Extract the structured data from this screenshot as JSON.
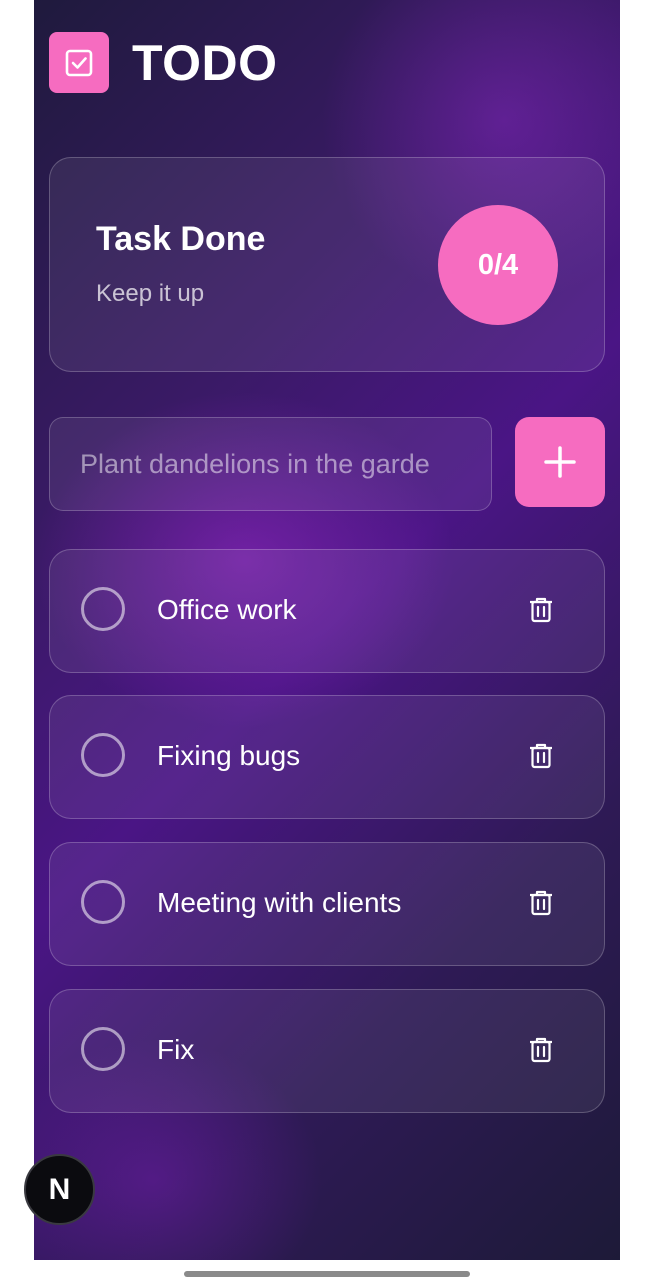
{
  "header": {
    "title": "TODO",
    "logo_icon": "checkbox-icon",
    "accent_color": "#f66cc0"
  },
  "summary": {
    "title": "Task Done",
    "subtitle": "Keep it up",
    "progress": "0/4"
  },
  "new_task": {
    "placeholder": "Plant dandelions in the garde",
    "add_icon": "plus-icon"
  },
  "tasks": [
    {
      "label": "Office work",
      "done": false
    },
    {
      "label": "Fixing bugs",
      "done": false
    },
    {
      "label": "Meeting with clients",
      "done": false
    },
    {
      "label": "Fix",
      "done": false
    }
  ],
  "dev_badge": {
    "letter": "N"
  }
}
